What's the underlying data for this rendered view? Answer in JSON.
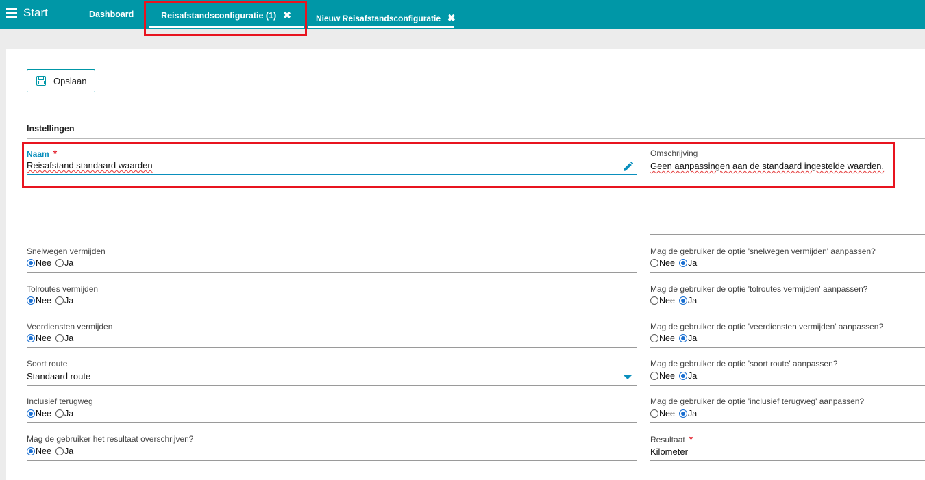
{
  "topbar": {
    "start_label": "Start",
    "tabs": [
      {
        "label": "Dashboard"
      },
      {
        "label": "Reisafstandsconfiguratie (1)",
        "close": "✖"
      },
      {
        "label": "Nieuw Reisafstandsconfiguratie",
        "close": "✖"
      }
    ]
  },
  "toolbar": {
    "save_label": "Opslaan"
  },
  "section": {
    "title": "Instellingen"
  },
  "naam": {
    "label": "Naam",
    "required": "*",
    "value": "Reisafstand standaard waarden"
  },
  "omschrijving": {
    "label": "Omschrijving",
    "value": "Geen aanpassingen aan de standaard ingestelde waarden."
  },
  "left_fields": [
    {
      "label": "Snelwegen vermijden",
      "options": [
        "Nee",
        "Ja"
      ],
      "selected": "Nee"
    },
    {
      "label": "Tolroutes vermijden",
      "options": [
        "Nee",
        "Ja"
      ],
      "selected": "Nee"
    },
    {
      "label": "Veerdiensten vermijden",
      "options": [
        "Nee",
        "Ja"
      ],
      "selected": "Nee"
    },
    {
      "label": "Soort route",
      "value": "Standaard route"
    },
    {
      "label": "Inclusief terugweg",
      "options": [
        "Nee",
        "Ja"
      ],
      "selected": "Nee"
    },
    {
      "label": "Mag de gebruiker het resultaat overschrijven?",
      "options": [
        "Nee",
        "Ja"
      ],
      "selected": "Nee"
    }
  ],
  "right_fields": [
    {
      "label": "Mag de gebruiker de optie 'snelwegen vermijden' aanpassen?",
      "options": [
        "Nee",
        "Ja"
      ],
      "selected": "Ja"
    },
    {
      "label": "Mag de gebruiker de optie 'tolroutes vermijden' aanpassen?",
      "options": [
        "Nee",
        "Ja"
      ],
      "selected": "Ja"
    },
    {
      "label": "Mag de gebruiker de optie 'veerdiensten vermijden' aanpassen?",
      "options": [
        "Nee",
        "Ja"
      ],
      "selected": "Ja"
    },
    {
      "label": "Mag de gebruiker de optie 'soort route' aanpassen?",
      "options": [
        "Nee",
        "Ja"
      ],
      "selected": "Ja"
    },
    {
      "label": "Mag de gebruiker de optie 'inclusief terugweg' aanpassen?",
      "options": [
        "Nee",
        "Ja"
      ],
      "selected": "Ja"
    },
    {
      "label": "Resultaat",
      "required": "*",
      "value": "Kilometer"
    }
  ],
  "colors": {
    "accent": "#0097a7",
    "highlight": "#e8141f",
    "label_active": "#0a8fbd"
  }
}
